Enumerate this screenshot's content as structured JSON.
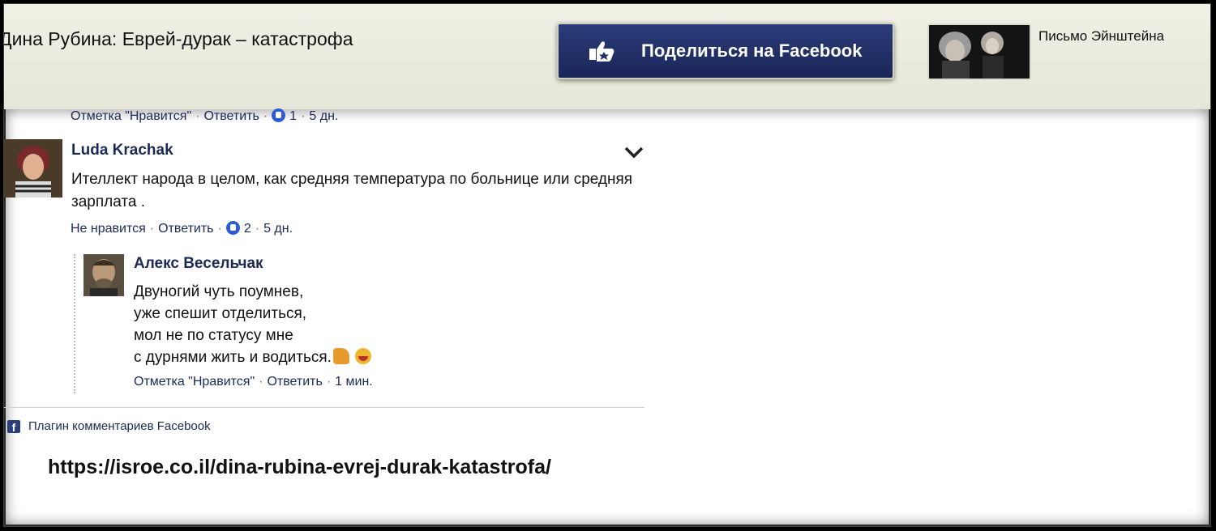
{
  "header": {
    "article_title": "Дина Рубина: Еврей-дурак – катастрофа",
    "share_button": "Поделиться на Facebook",
    "related_title": "Письмо Эйнштейна"
  },
  "previous_comment": {
    "like": "Отметка \"Нравится\"",
    "reply": "Ответить",
    "likes_count": "1",
    "time": "5 дн."
  },
  "comments": [
    {
      "author": "Luda Krachak",
      "text": "Ителлект народа в целом, как средняя температура по больнице или средняя зарплата .",
      "like": "Не нравится",
      "reply": "Ответить",
      "likes_count": "2",
      "time": "5 дн.",
      "replies": [
        {
          "author": "Алекс Весельчак",
          "lines": [
            "Двуногий чуть поумнев,",
            "уже спешит отделиться,",
            "мол не по статусу мне",
            "с дурнями жить и водиться."
          ],
          "emojis": [
            "thumbs-up",
            "grinning-face"
          ],
          "like": "Отметка \"Нравится\"",
          "reply": "Ответить",
          "time": "1 мин."
        }
      ]
    }
  ],
  "footer": {
    "plugin_label": "Плагин комментариев Facebook",
    "url": "https://isroe.co.il/dina-rubina-evrej-durak-katastrofa/"
  },
  "colors": {
    "link": "#1b2a55",
    "share_button": "#1f2c63",
    "header_bg": "#eeeee3"
  }
}
